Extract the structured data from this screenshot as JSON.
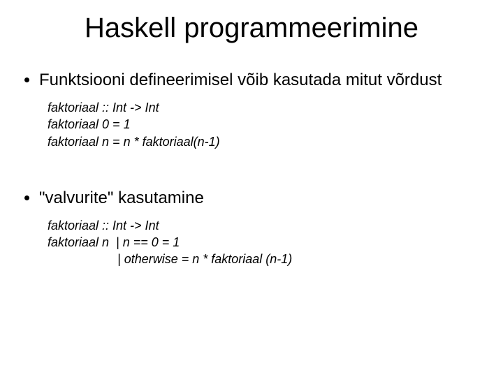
{
  "title": "Haskell programmeerimine",
  "bullets": {
    "b1": "Funktsiooni defineerimisel võib kasutada mitut võrdust",
    "b2": "\"valvurite\" kasutamine"
  },
  "code1": {
    "l1": "faktoriaal :: Int -> Int",
    "l2": "faktoriaal 0 = 1",
    "l3": "faktoriaal n = n * faktoriaal(n-1)"
  },
  "code2": {
    "l1": "faktoriaal :: Int -> Int",
    "l2": "faktoriaal n  | n == 0 = 1",
    "l3": "                    | otherwise = n * faktoriaal (n-1)"
  }
}
